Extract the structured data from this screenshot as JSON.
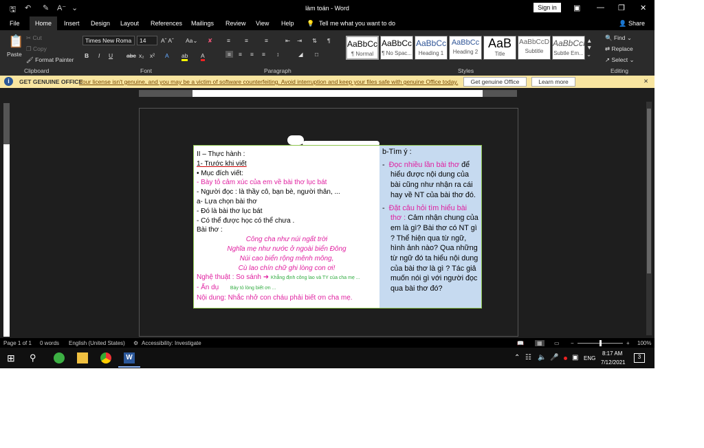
{
  "title": "làm toán  -  Word",
  "signin": "Sign in",
  "share": "Share",
  "tabs": [
    "File",
    "Home",
    "Insert",
    "Design",
    "Layout",
    "References",
    "Mailings",
    "Review",
    "View",
    "Help"
  ],
  "tellme": "Tell me what you want to do",
  "clipboard": {
    "paste": "Paste",
    "cut": "Cut",
    "copy": "Copy",
    "painter": "Format Painter",
    "label": "Clipboard"
  },
  "font": {
    "name": "Times New Roma",
    "size": "14",
    "label": "Font"
  },
  "paragraph_label": "Paragraph",
  "styles": [
    {
      "sample": "AaBbCc",
      "name": "¶ Normal"
    },
    {
      "sample": "AaBbCc",
      "name": "¶ No Spac..."
    },
    {
      "sample": "AaBbCc",
      "name": "Heading 1"
    },
    {
      "sample": "AaBbCc",
      "name": "Heading 2"
    },
    {
      "sample": "AaB",
      "name": "Title"
    },
    {
      "sample": "AaBbCcD",
      "name": "Subtitle"
    },
    {
      "sample": "AaBbCcI",
      "name": "Subtle Em..."
    }
  ],
  "styles_label": "Styles",
  "editing": {
    "find": "Find",
    "replace": "Replace",
    "select": "Select",
    "label": "Editing"
  },
  "msgbar": {
    "title": "GET GENUINE OFFICE",
    "text": "Your license isn't genuine, and you may be a victim of software counterfeiting. Avoid interruption and keep your files safe with genuine Office today.",
    "btn1": "Get genuine Office",
    "btn2": "Learn more"
  },
  "doc": {
    "left": [
      "II – Thực hành :",
      "1- Trước khi viết",
      "•    Mục đích viết:",
      "-    Bày tỏ cảm xúc của em về bài thơ lục bát",
      "-    Người đọc : là thầy cô, bạn bè, người thân, ...",
      "a- Lựa chọn bài thơ",
      "-    Đó là bài thơ lục bát",
      "-    Có thể được học có thể chưa .",
      "Bài thơ :"
    ],
    "poem": [
      "Công cha như núi ngất trời",
      "Nghĩa mẹ như nước ở ngoài biển Đông",
      "Núi cao biển rộng mênh mông,",
      "Cù lao chín chữ ghi lòng con ơi!"
    ],
    "art": "Nghệ thuật : So sánh",
    "art_note": "Khẳng định công lao và TY của cha mẹ ...",
    "hidden": "- Ẩn dụ",
    "hidden_note": "Bày tỏ lòng biết ơn ...",
    "content": "Nội dung: Nhắc nhở con cháu phải biết ơn cha mẹ.",
    "right_title": "b-Tìm ý :",
    "right_b1_mag": "Đọc nhiều lần bài thơ",
    "right_b1": " để hiểu được nội dung của bài cũng như nhận ra cái hay về NT của bài thơ đó.",
    "right_b2_mag": "Đặt câu hỏi tìm hiểu bài thơ :",
    "right_b2": " Cảm nhận chung của em là gì?  Bài thơ có NT gì ? Thể hiện qua từ ngữ, hình ảnh nào? Qua những từ ngữ đó ta hiểu nội dung của bài thơ là gì ? Tác giả muốn nói gì với người đọc qua bài thơ đó?"
  },
  "status": {
    "page": "Page 1 of 1",
    "words": "0 words",
    "lang": "English (United States)",
    "access": "Accessibility: Investigate",
    "zoom": "100%"
  },
  "taskbar": {
    "lang": "ENG",
    "time": "8:17 AM",
    "date": "7/12/2021",
    "notif": "3"
  }
}
